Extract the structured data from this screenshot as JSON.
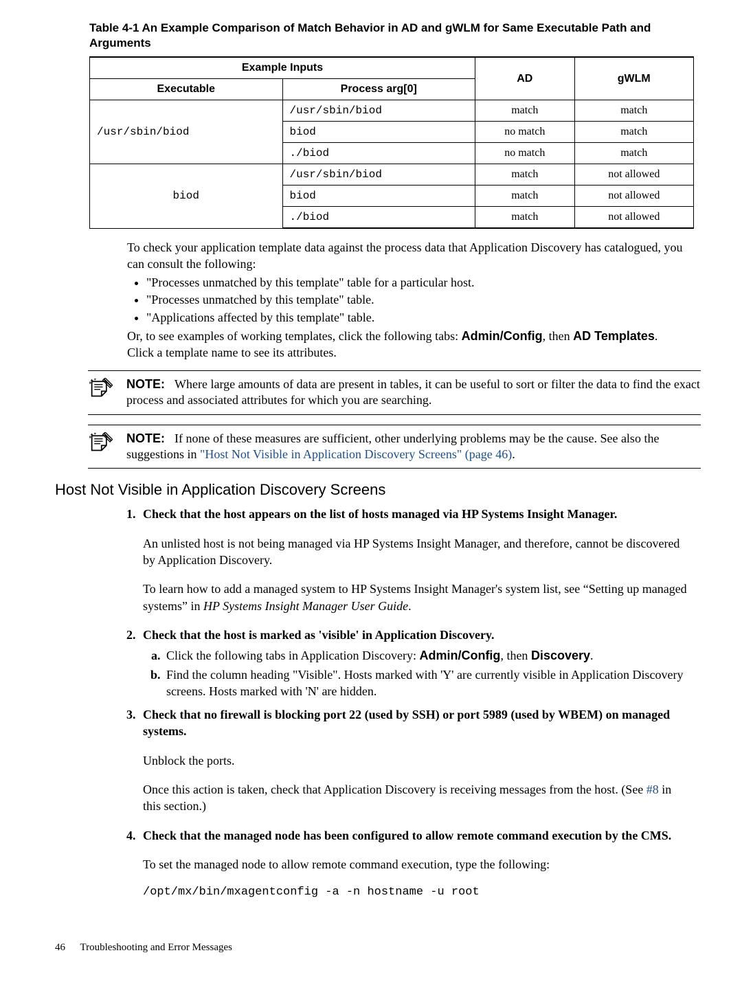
{
  "table": {
    "caption": "Table 4-1 An Example Comparison of Match Behavior in AD and gWLM for Same Executable Path and Arguments",
    "head": {
      "example_inputs": "Example Inputs",
      "ad": "AD",
      "gwlm": "gWLM",
      "executable": "Executable",
      "process_arg": "Process arg[0]"
    },
    "rows": [
      {
        "exec": "/usr/sbin/biod",
        "proc": "/usr/sbin/biod",
        "ad": "match",
        "gwlm": "match",
        "rowspan": 3
      },
      {
        "proc": "biod",
        "ad": "no match",
        "gwlm": "match"
      },
      {
        "proc": "./biod",
        "ad": "no match",
        "gwlm": "match"
      },
      {
        "exec": "biod",
        "proc": "/usr/sbin/biod",
        "ad": "match",
        "gwlm": "not allowed",
        "rowspan": 3
      },
      {
        "proc": "biod",
        "ad": "match",
        "gwlm": "not allowed"
      },
      {
        "proc": "./biod",
        "ad": "match",
        "gwlm": "not allowed"
      }
    ]
  },
  "intro": {
    "p1": "To check your application template data against the process data that Application Discovery has catalogued, you can consult the following:",
    "bullets": [
      "\"Processes unmatched by this template\" table for a particular host.",
      "\"Processes unmatched by this template\" table.",
      "\"Applications affected by this template\" table."
    ],
    "p2_a": "Or, to see examples of working templates, click the following tabs: ",
    "p2_b": "Admin/Config",
    "p2_c": ", then ",
    "p2_d": "AD Templates",
    "p2_e": ". Click a template name to see its attributes."
  },
  "note1": {
    "label": "NOTE:",
    "text": "Where large amounts of data are present in tables, it can be useful to sort or filter the data to find the exact process and associated attributes for which you are searching."
  },
  "note2": {
    "label": "NOTE:",
    "text_a": "If none of these measures are sufficient, other underlying problems may be the cause. See also the suggestions in ",
    "link": "\"Host Not Visible in Application Discovery Screens\" (page 46)",
    "text_b": "."
  },
  "section_title": "Host Not Visible in Application Discovery Screens",
  "steps": {
    "s1": {
      "title": "Check that the host appears on the list of hosts managed via HP Systems Insight Manager.",
      "p1": "An unlisted host is not being managed via HP Systems Insight Manager, and therefore, cannot be discovered by Application Discovery.",
      "p2a": "To learn how to add a managed system to HP Systems Insight Manager's system list, see “Setting up managed systems” in ",
      "p2b": "HP Systems Insight Manager User Guide",
      "p2c": "."
    },
    "s2": {
      "title": "Check that the host is marked as 'visible' in Application Discovery.",
      "a_a": "Click the following tabs in Application Discovery: ",
      "a_b": "Admin/Config",
      "a_c": ", then ",
      "a_d": "Discovery",
      "a_e": ".",
      "b": "Find the column heading \"Visible\". Hosts marked with 'Y' are currently visible in Application Discovery screens. Hosts marked with 'N' are hidden."
    },
    "s3": {
      "title": "Check that no firewall is blocking port 22 (used by SSH) or port 5989 (used by WBEM) on managed systems.",
      "p1": "Unblock the ports.",
      "p2a": "Once this action is taken, check that Application Discovery is receiving messages from the host. (See ",
      "p2b": "#8",
      "p2c": " in this section.)"
    },
    "s4": {
      "title": "Check that the managed node has been configured to allow remote command execution by the CMS.",
      "p1": "To set the managed node to allow remote command execution, type the following:",
      "cmd": "/opt/mx/bin/mxagentconfig -a -n hostname -u root"
    }
  },
  "footer": {
    "page": "46",
    "title": "Troubleshooting and Error Messages"
  }
}
